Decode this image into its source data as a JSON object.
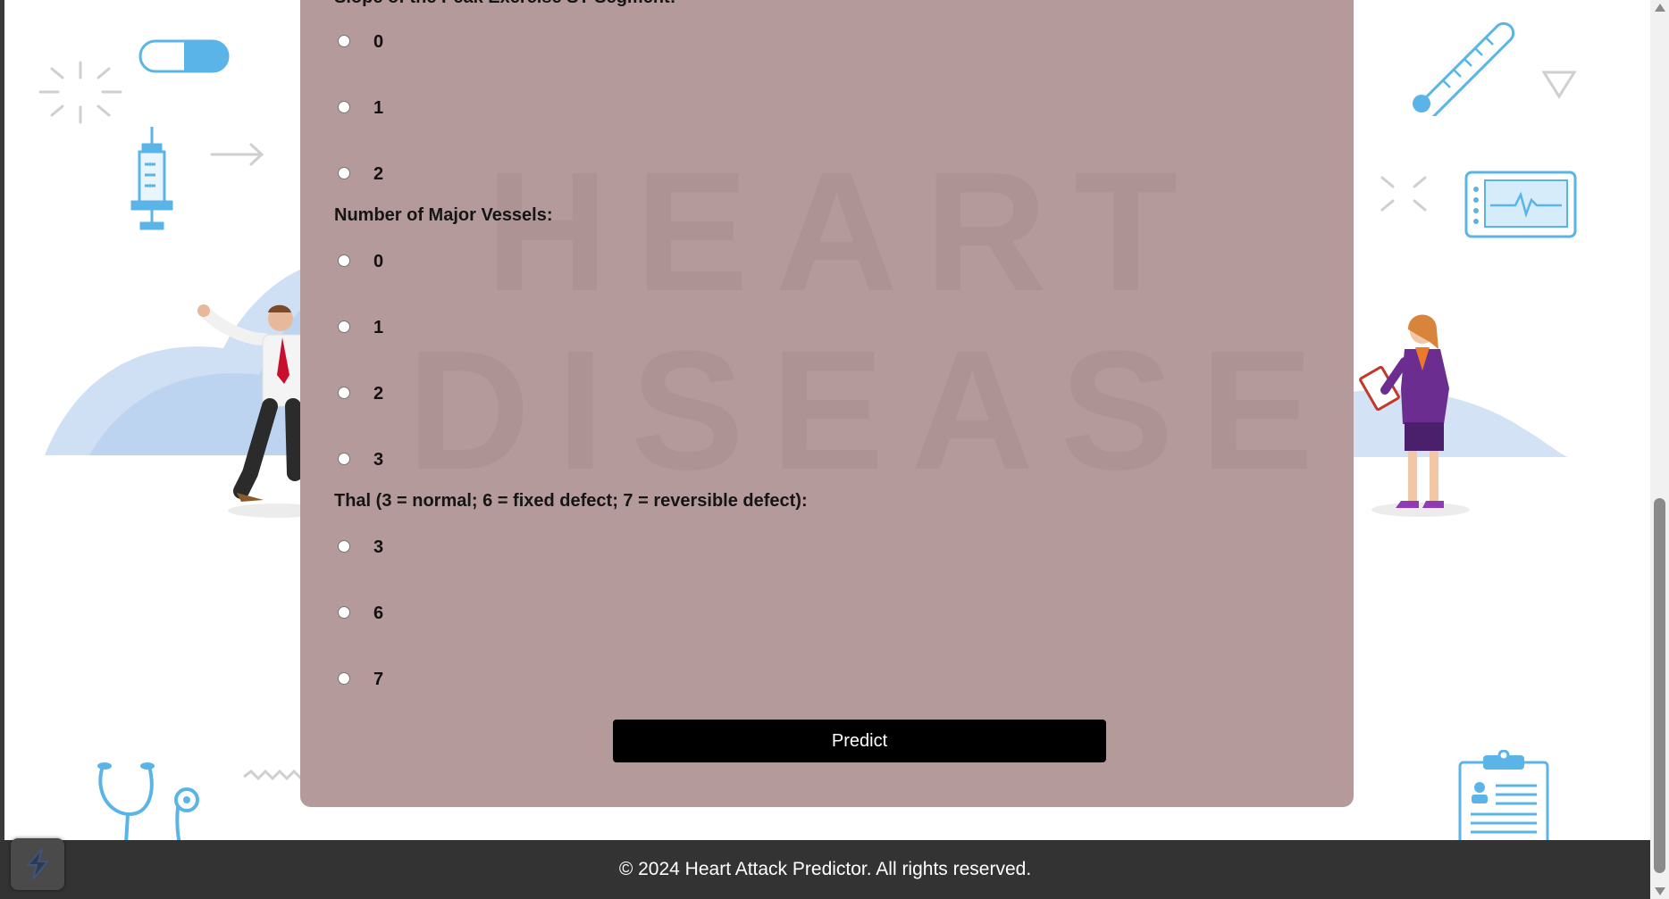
{
  "form": {
    "partial_label": "Slope of the Peak Exercise ST Segment:",
    "slope_options": [
      "0",
      "1",
      "2"
    ],
    "vessels_label": "Number of Major Vessels:",
    "vessels_options": [
      "0",
      "1",
      "2",
      "3"
    ],
    "thal_label": "Thal (3 = normal; 6 = fixed defect; 7 = reversible defect):",
    "thal_options": [
      "3",
      "6",
      "7"
    ],
    "predict_label": "Predict"
  },
  "footer": {
    "text": "© 2024 Heart Attack Predictor. All rights reserved."
  },
  "colors": {
    "panel": "#b59a9b",
    "button": "#000000",
    "footer": "#333333",
    "icon_blue": "#5bb4e8"
  }
}
